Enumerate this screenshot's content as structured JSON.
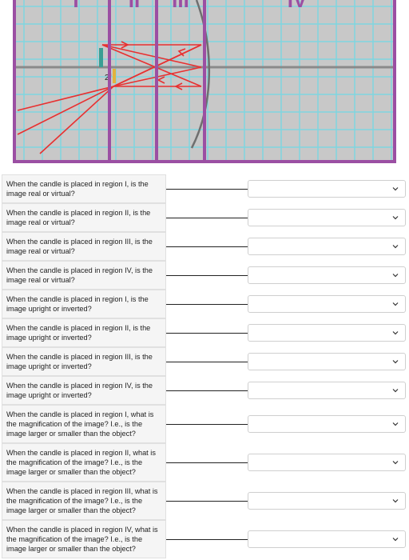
{
  "figure": {
    "region_labels": [
      "I",
      "II",
      "III",
      "IV"
    ],
    "object_label": "2f",
    "colors": {
      "frame": "#9b4fa3",
      "grid": "#7fd6df",
      "background": "#c8c8c8",
      "axis": "#8a8a8a",
      "rays": "#e83030",
      "mirror": "#6f6f6f",
      "candle_object": "#3a9e93",
      "candle_image": "#e3b23c"
    }
  },
  "questions": [
    {
      "text": "When the candle is placed in region I, is the image real or virtual?",
      "selected": ""
    },
    {
      "text": "When the candle is placed in region II, is the image real or virtual?",
      "selected": ""
    },
    {
      "text": "When the candle is placed in region III, is the image real or virtual?",
      "selected": ""
    },
    {
      "text": "When the candle is placed in region IV, is the image real or virtual?",
      "selected": ""
    },
    {
      "text": "When the candle is placed in region I, is the image upright or inverted?",
      "selected": ""
    },
    {
      "text": "When the candle is placed in region II, is the image upright or inverted?",
      "selected": ""
    },
    {
      "text": "When the candle is placed in region III, is the image upright or inverted?",
      "selected": ""
    },
    {
      "text": "When the candle is placed in region IV, is the image upright or inverted?",
      "selected": ""
    },
    {
      "text": "When the candle is placed in region I, what is the magnification of the image? I.e., is the image larger or smaller than the object?",
      "selected": ""
    },
    {
      "text": "When the candle is placed in region II, what is the magnification of the image? I.e., is the image larger or smaller than the object?",
      "selected": ""
    },
    {
      "text": "When the candle is placed in region III, what is the magnification of the image? I.e., is the image larger or smaller than the object?",
      "selected": ""
    },
    {
      "text": "When the candle is placed in region IV, what is the magnification of the image? I.e., is the image larger or smaller than the object?",
      "selected": ""
    }
  ]
}
